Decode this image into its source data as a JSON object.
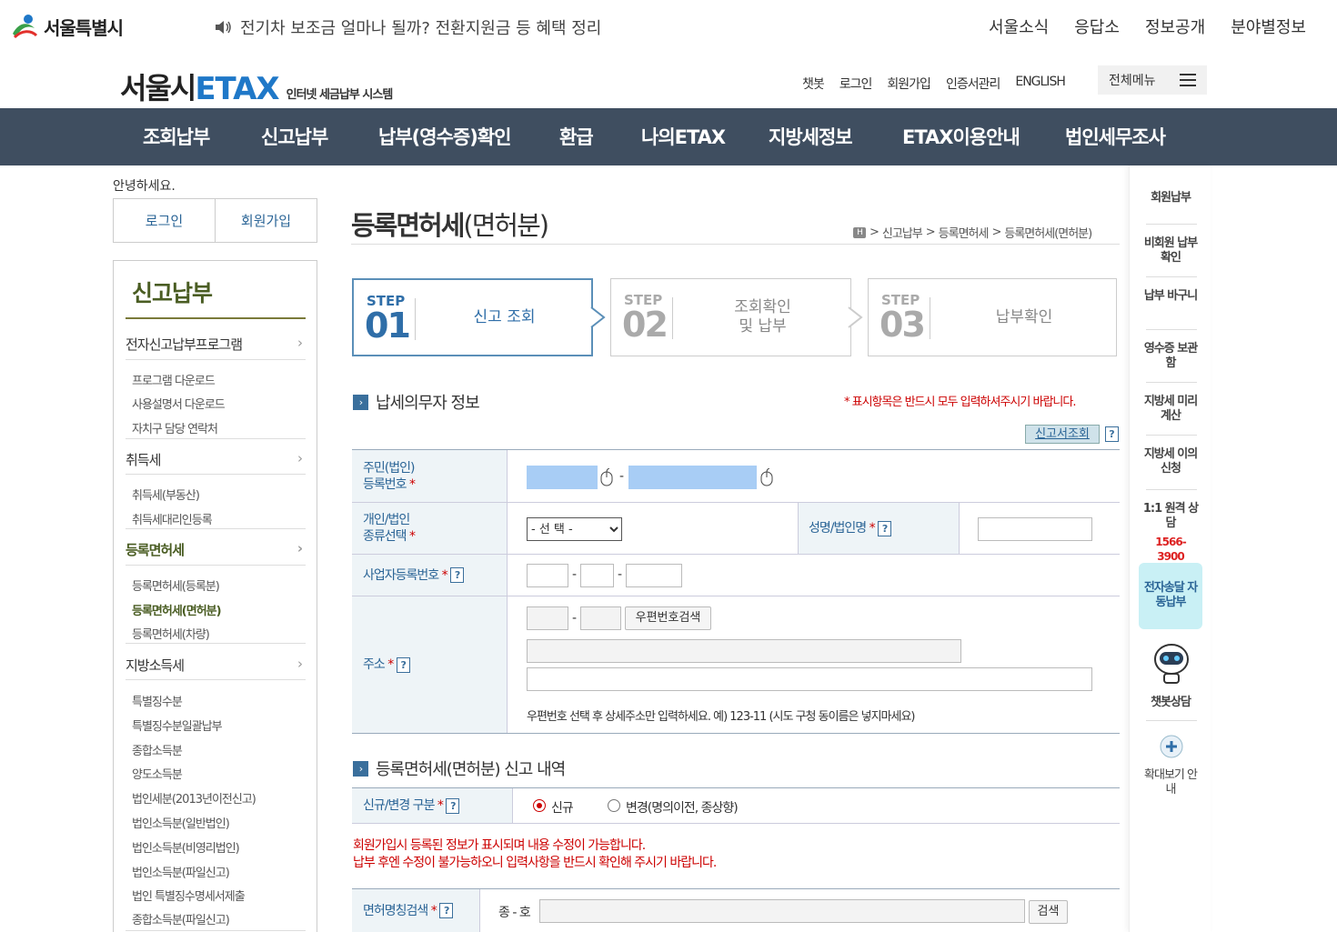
{
  "topbar": {
    "logo_text": "서울특별시",
    "notice": "전기차 보조금 얼마나 될까? 전환지원금 등 혜택 정리",
    "links": [
      "서울소식",
      "응답소",
      "정보공개",
      "분야별정보"
    ]
  },
  "header": {
    "logo_a": "서울시",
    "logo_b": "ETAX",
    "logo_sub": "인터넷 세금납부 시스템",
    "util_links": [
      "챗봇",
      "로그인",
      "회원가입",
      "인증서관리",
      "ENGLISH"
    ],
    "all_menu": "전체메뉴"
  },
  "gnb": [
    "조회납부",
    "신고납부",
    "납부(영수증)확인",
    "환급",
    "나의ETAX",
    "지방세정보",
    "ETAX이용안내",
    "법인세무조사"
  ],
  "left": {
    "greeting": "안녕하세요.",
    "login": "로그인",
    "join": "회원가입",
    "title": "신고납부",
    "cat1": "전자신고납부프로그램",
    "cat1_items": [
      "프로그램 다운로드",
      "사용설명서 다운로드",
      "자치구 담당 연락처"
    ],
    "cat2": "취득세",
    "cat2_items": [
      "취득세(부동산)",
      "취득세대리인등록"
    ],
    "cat3": "등록면허세",
    "cat3_items": [
      "등록면허세(등록분)",
      "등록면허세(면허분)",
      "등록면허세(차량)"
    ],
    "cat4": "지방소득세",
    "cat4_items": [
      "특별징수분",
      "특별징수분일괄납부",
      "종합소득분",
      "양도소득분",
      "법인세분(2013년이전신고)",
      "법인소득분(일반법인)",
      "법인소득분(비영리법인)",
      "법인소득분(파일신고)",
      "법인 특별징수명세서제출",
      "종합소득분(파일신고)"
    ]
  },
  "main": {
    "title": "등록면허세",
    "title_sub": "(면허분)",
    "breadcrumb": [
      "신고납부",
      "등록면허세",
      "등록면허세(면허분)"
    ],
    "steps": [
      {
        "label": "STEP",
        "num": "01",
        "text": "신고 조회"
      },
      {
        "label": "STEP",
        "num": "02",
        "text1": "조회확인",
        "text2": "및 납부"
      },
      {
        "label": "STEP",
        "num": "03",
        "text": "납부확인"
      }
    ],
    "sec1": "납세의무자 정보",
    "req_note": "* 표시항목은 반드시 모두 입력하셔주시기 바랍니다.",
    "lookup_btn": "신고서조회",
    "f_id1": "주민(법인)",
    "f_id2": "등록번호",
    "f_type1": "개인/법인",
    "f_type2": "종류선택",
    "f_type_select": "- 선 택 -",
    "f_name": "성명/법인명",
    "f_biz": "사업자등록번호",
    "f_addr": "주소",
    "zip_btn": "우편번호검색",
    "addr_note": "우편번호 선택 후 상세주소만 입력하세요. 예) 123-11 (시도 구청 동이름은 넣지마세요)",
    "sec2": "등록면허세(면허분) 신고 내역",
    "f_kind": "신규/변경 구분",
    "radio_new": "신규",
    "radio_change": "변경(명의이전, 종상향)",
    "warn1": "회원가입시 등록된 정보가 표시되며 내용 수정이 가능합니다.",
    "warn2": "납부 후엔 수정이 불가능하오니 입력사항을 반드시 확인해 주시기 바랍니다.",
    "f_license": "면허명칭검색",
    "f_class": "종 - 호",
    "search_btn": "검색"
  },
  "quick": {
    "items": [
      "회원납부",
      "비회원 납부확인",
      "납부 바구니",
      "영수증 보관함",
      "지방세 미리계산",
      "지방세 이의신청",
      "1:1 원격 상담"
    ],
    "phone": "1566-3900",
    "auto_pay": "전자송달 자동납부",
    "chatbot": "챗봇상담",
    "zoom": "확대보기 안내"
  }
}
